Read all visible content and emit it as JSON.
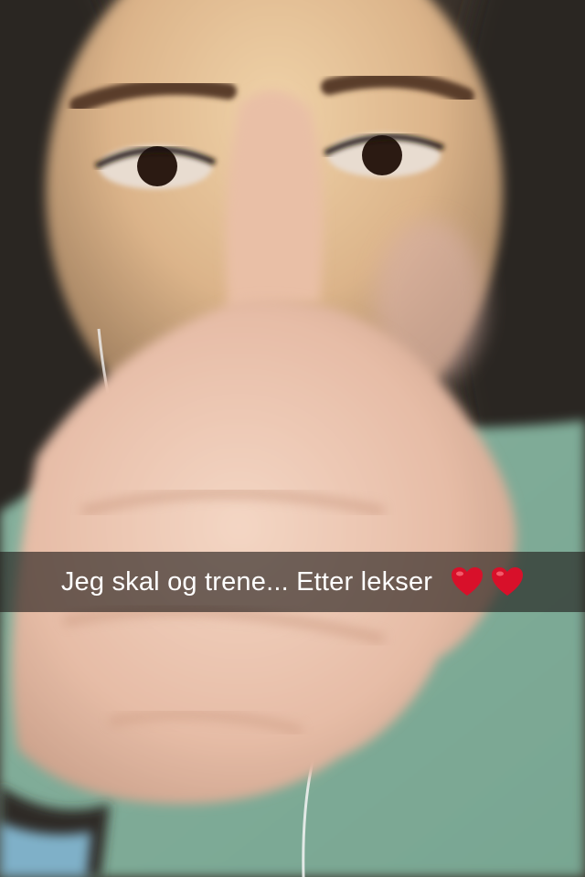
{
  "snap": {
    "caption": "Jeg skal og trene... Etter lekser",
    "emoji": [
      "heart-icon",
      "heart-icon"
    ],
    "heart_color": "#d8102a"
  }
}
